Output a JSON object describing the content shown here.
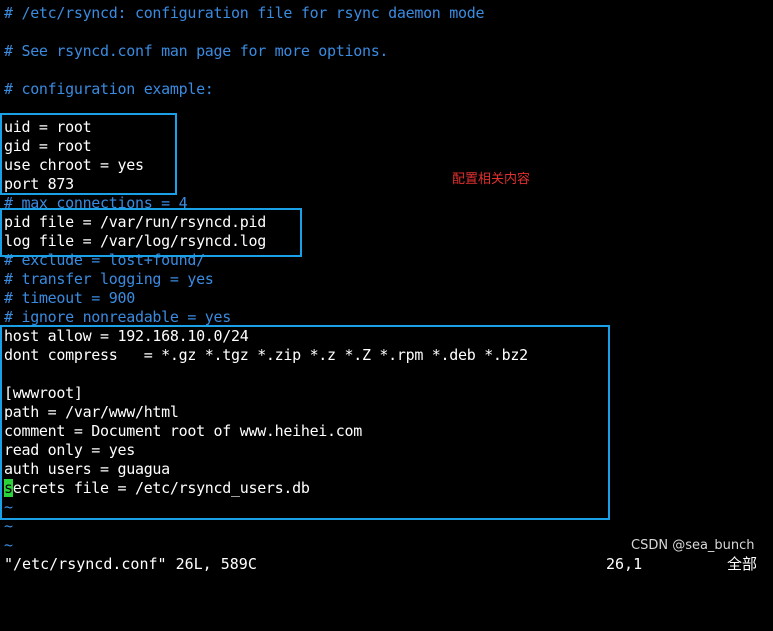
{
  "editor": {
    "lines": [
      {
        "text": "# /etc/rsyncd: configuration file for rsync daemon mode",
        "kind": "comment"
      },
      {
        "text": "",
        "kind": "plain"
      },
      {
        "text": "# See rsyncd.conf man page for more options.",
        "kind": "comment"
      },
      {
        "text": "",
        "kind": "plain"
      },
      {
        "text": "# configuration example:",
        "kind": "comment"
      },
      {
        "text": "",
        "kind": "plain"
      },
      {
        "text": "uid = root",
        "kind": "plain"
      },
      {
        "text": "gid = root",
        "kind": "plain"
      },
      {
        "text": "use chroot = yes",
        "kind": "plain"
      },
      {
        "text": "port 873",
        "kind": "plain"
      },
      {
        "text": "# max connections = 4",
        "kind": "comment"
      },
      {
        "text": "pid file = /var/run/rsyncd.pid",
        "kind": "plain"
      },
      {
        "text": "log file = /var/log/rsyncd.log",
        "kind": "plain"
      },
      {
        "text": "# exclude = lost+found/",
        "kind": "comment"
      },
      {
        "text": "# transfer logging = yes",
        "kind": "comment"
      },
      {
        "text": "# timeout = 900",
        "kind": "comment"
      },
      {
        "text": "# ignore nonreadable = yes",
        "kind": "comment"
      },
      {
        "text": "host allow = 192.168.10.0/24",
        "kind": "plain"
      },
      {
        "text": "dont compress   = *.gz *.tgz *.zip *.z *.Z *.rpm *.deb *.bz2",
        "kind": "plain"
      },
      {
        "text": "",
        "kind": "plain"
      },
      {
        "text": "[wwwroot]",
        "kind": "plain"
      },
      {
        "text": "path = /var/www/html",
        "kind": "plain"
      },
      {
        "text": "comment = Document root of www.heihei.com",
        "kind": "plain"
      },
      {
        "text": "read only = yes",
        "kind": "plain"
      },
      {
        "text": "auth users = guagua",
        "kind": "plain"
      },
      {
        "text": "secrets file = /etc/rsyncd_users.db",
        "kind": "cursor"
      },
      {
        "text": "~",
        "kind": "tilde"
      },
      {
        "text": "~",
        "kind": "tilde"
      },
      {
        "text": "~",
        "kind": "tilde"
      }
    ],
    "cursor_line": 25
  },
  "annotation": {
    "text": "配置相关内容",
    "color": "#e03030"
  },
  "status": {
    "file": "\"/etc/rsyncd.conf\" 26L, 589C",
    "position": "26,1",
    "scroll": "全部"
  },
  "watermark": "CSDN @sea_bunch",
  "colors": {
    "background": "#000000",
    "comment": "#3a8be0",
    "text": "#ffffff",
    "cursor": "#2bd33a",
    "highlight_box": "#1aa0e6"
  }
}
